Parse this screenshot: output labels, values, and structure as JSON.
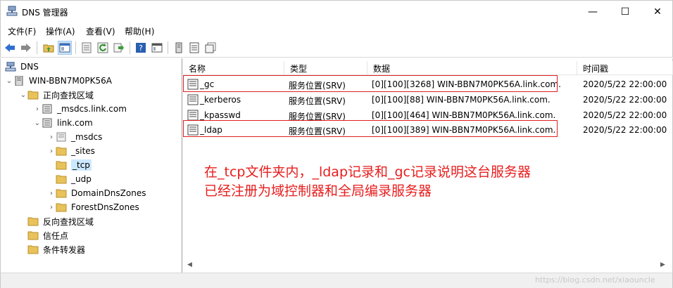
{
  "window": {
    "title": "DNS 管理器",
    "minimize": "—",
    "maximize": "☐",
    "close": "✕"
  },
  "menu": [
    {
      "label": "文件(F)"
    },
    {
      "label": "操作(A)"
    },
    {
      "label": "查看(V)"
    },
    {
      "label": "帮助(H)"
    }
  ],
  "tree": {
    "root": "DNS",
    "server": "WIN-BBN7M0PK56A",
    "forward_zone": "正向查找区域",
    "msdcs_zone": "_msdcs.link.com",
    "link_zone": "link.com",
    "msdcs": "_msdcs",
    "sites": "_sites",
    "tcp": "_tcp",
    "udp": "_udp",
    "domain_dns": "DomainDnsZones",
    "forest_dns": "ForestDnsZones",
    "reverse_zone": "反向查找区域",
    "trust_points": "信任点",
    "forwarders": "条件转发器"
  },
  "columns": {
    "name": "名称",
    "type": "类型",
    "data": "数据",
    "timestamp": "时间戳"
  },
  "records": [
    {
      "name": "_gc",
      "type": "服务位置(SRV)",
      "data": "[0][100][3268] WIN-BBN7M0PK56A.link.com.",
      "timestamp": "2020/5/22 22:00:00"
    },
    {
      "name": "_kerberos",
      "type": "服务位置(SRV)",
      "data": "[0][100][88] WIN-BBN7M0PK56A.link.com.",
      "timestamp": "2020/5/22 22:00:00"
    },
    {
      "name": "_kpasswd",
      "type": "服务位置(SRV)",
      "data": "[0][100][464] WIN-BBN7M0PK56A.link.com.",
      "timestamp": "2020/5/22 22:00:00"
    },
    {
      "name": "_ldap",
      "type": "服务位置(SRV)",
      "data": "[0][100][389] WIN-BBN7M0PK56A.link.com.",
      "timestamp": "2020/5/22 22:00:00"
    }
  ],
  "annotation": {
    "line1": "在_tcp文件夹内，_ldap记录和_gc记录说明这台服务器",
    "line2": "已经注册为域控制器和全局编录服务器"
  },
  "scroll": {
    "left": "◀",
    "right": "▶"
  },
  "watermark": "https://blog.csdn.net/xiaouncle",
  "colors": {
    "annotation": "#e81d1d",
    "box": "#e02020",
    "selection": "#cce8ff",
    "folder": "#e8c25a"
  },
  "icons": [
    "dns-app-icon",
    "back-icon",
    "forward-icon",
    "up-folder-icon",
    "show-tree-icon",
    "properties-icon",
    "refresh-icon",
    "export-icon",
    "help-icon",
    "console-icon",
    "server-icon",
    "record-list-icon",
    "record-copy-icon"
  ]
}
